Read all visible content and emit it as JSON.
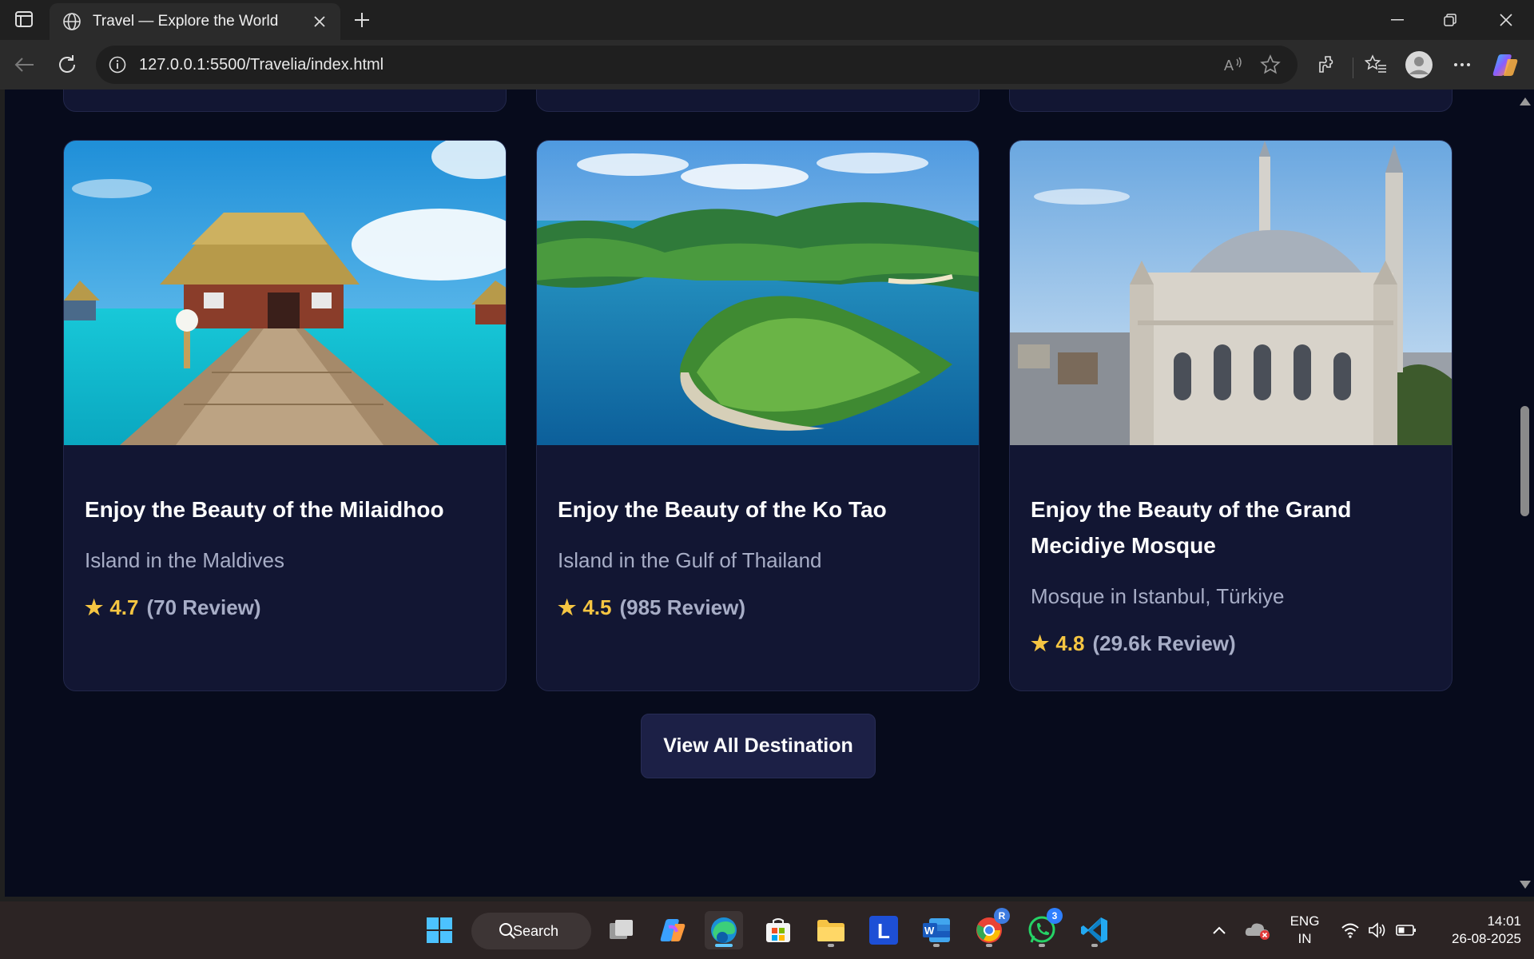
{
  "browser": {
    "tab_title": "Travel — Explore the World",
    "url": "127.0.0.1:5500/Travelia/index.html"
  },
  "destinations": [
    {
      "title": "Enjoy the Beauty of the Milaidhoo",
      "subtitle": "Island in the Maldives",
      "rating": "4.7",
      "reviews": "(70 Review)"
    },
    {
      "title": "Enjoy the Beauty of the Ko Tao",
      "subtitle": "Island in the Gulf of Thailand",
      "rating": "4.5",
      "reviews": "(985 Review)"
    },
    {
      "title": "Enjoy the Beauty of the Grand Mecidiye Mosque",
      "subtitle": "Mosque in Istanbul, Türkiye",
      "rating": "4.8",
      "reviews": "(29.6k Review)"
    }
  ],
  "view_all_label": "View All Destination",
  "taskbar": {
    "search_label": "Search",
    "whatsapp_badge": "3",
    "chrome_badge": "R",
    "lang_line1": "ENG",
    "lang_line2": "IN",
    "time": "14:01",
    "date": "26-08-2025"
  },
  "colors": {
    "page_bg": "#070b1c",
    "card_bg": "#121633",
    "star": "#f5c542",
    "muted_text": "#a7adc6"
  }
}
